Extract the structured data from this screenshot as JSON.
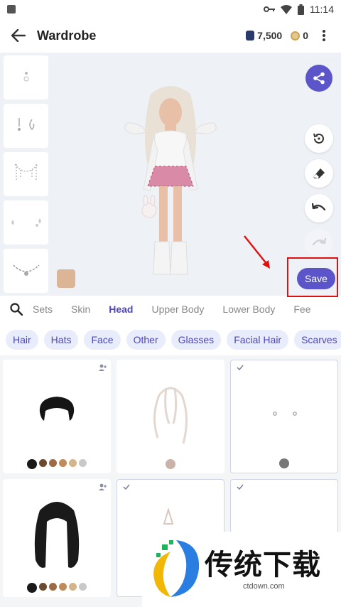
{
  "status_bar": {
    "time": "11:14"
  },
  "app_bar": {
    "title": "Wardrobe",
    "gems": "7,500",
    "coins": "0"
  },
  "preview": {
    "save_label": "Save",
    "skin_color": "#dcb596"
  },
  "tabs": [
    {
      "label": "Sets",
      "active": false
    },
    {
      "label": "Skin",
      "active": false
    },
    {
      "label": "Head",
      "active": true
    },
    {
      "label": "Upper Body",
      "active": false
    },
    {
      "label": "Lower Body",
      "active": false
    },
    {
      "label": "Fee",
      "active": false
    }
  ],
  "chips": [
    "Hair",
    "Hats",
    "Face",
    "Other",
    "Glasses",
    "Facial Hair",
    "Scarves"
  ],
  "items": [
    {
      "item": "short-black-hair",
      "selected": false,
      "has_badge": true,
      "swatches": [
        "#1a1a1a",
        "#6b4a2f",
        "#9c6b45",
        "#c08a5b",
        "#d4b48a",
        "#c9c9c9"
      ]
    },
    {
      "item": "white-wavy-hair",
      "selected": false,
      "has_badge": false,
      "swatches": [
        "#c9b3a8"
      ]
    },
    {
      "item": "earrings",
      "selected": true,
      "has_badge": false,
      "swatches": [
        "#777777"
      ]
    },
    {
      "item": "long-black-hair",
      "selected": false,
      "has_badge": true,
      "swatches": [
        "#1a1a1a",
        "#6b4a2f",
        "#9c6b45",
        "#c08a5b",
        "#d4b48a",
        "#c9c9c9"
      ]
    },
    {
      "item": "accessory",
      "selected": true,
      "has_badge": false,
      "swatches": []
    },
    {
      "item": "empty",
      "selected": true,
      "has_badge": false,
      "swatches": []
    }
  ],
  "watermark": {
    "text": "传统下载",
    "url": "ctdown.com"
  },
  "colors": {
    "accent": "#5b55c9",
    "chip_bg": "#e8ecfb",
    "highlight": "#e01010"
  }
}
